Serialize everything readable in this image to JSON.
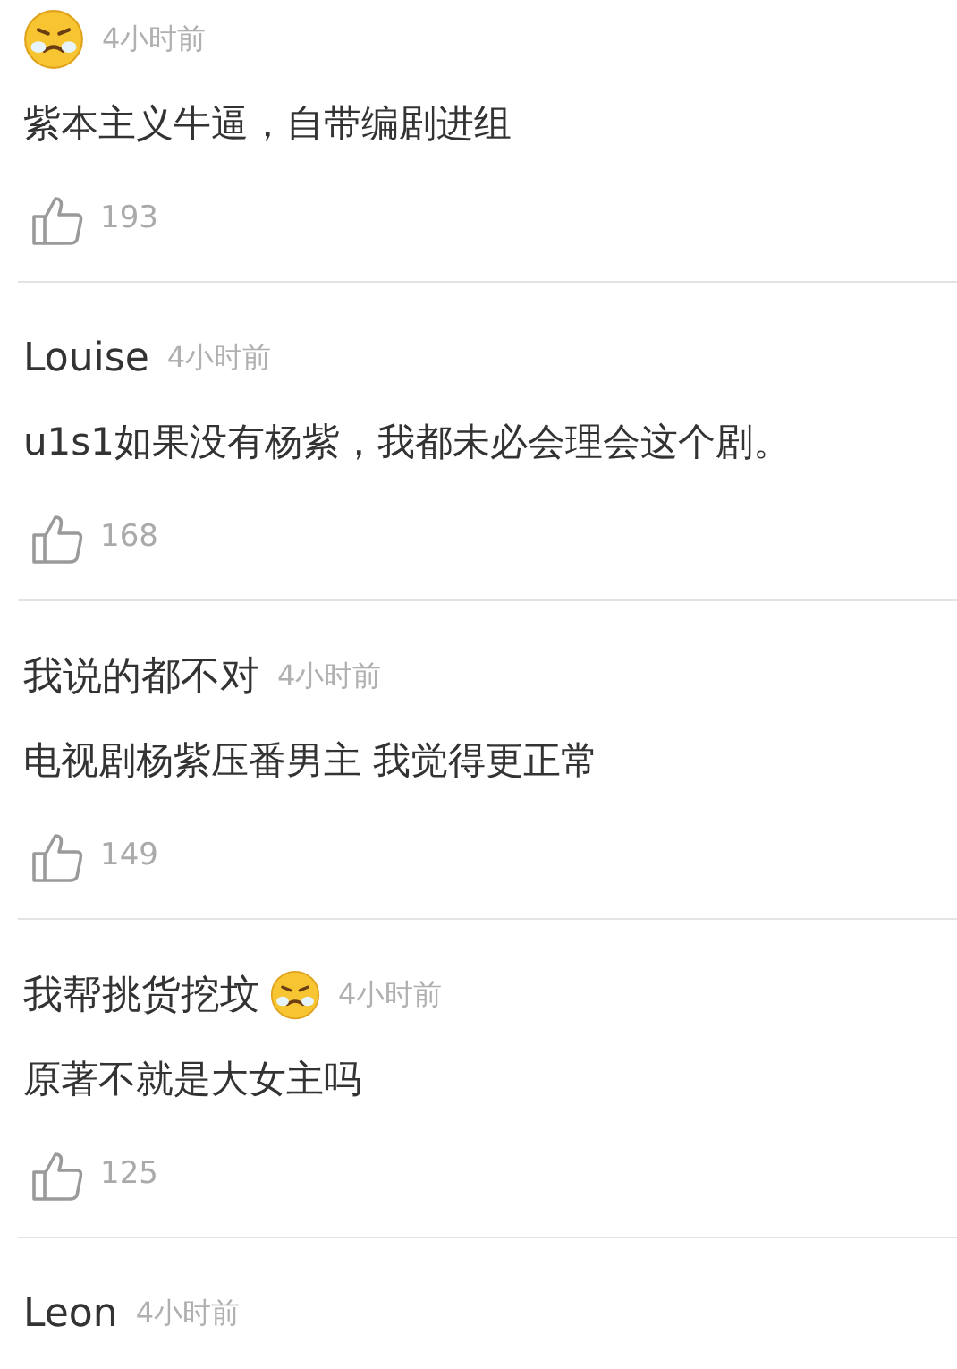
{
  "comments": [
    {
      "name_emoji": true,
      "time": "4小时前",
      "text": "紫本主义牛逼，自带编剧进组",
      "likes": "193"
    },
    {
      "name": "Louise",
      "name_emoji": false,
      "time": "4小时前",
      "text": "u1s1如果没有杨紫，我都未必会理会这个剧。",
      "likes": "168"
    },
    {
      "name": "我说的都不对",
      "name_emoji": false,
      "time": "4小时前",
      "text": "电视剧杨紫压番男主 我觉得更正常",
      "likes": "149"
    },
    {
      "name": "我帮挑货挖坟",
      "name_emoji": true,
      "time": "4小时前",
      "text": "原著不就是大女主吗",
      "likes": "125"
    },
    {
      "name": "Leon",
      "name_emoji": false,
      "time": "4小时前"
    }
  ]
}
